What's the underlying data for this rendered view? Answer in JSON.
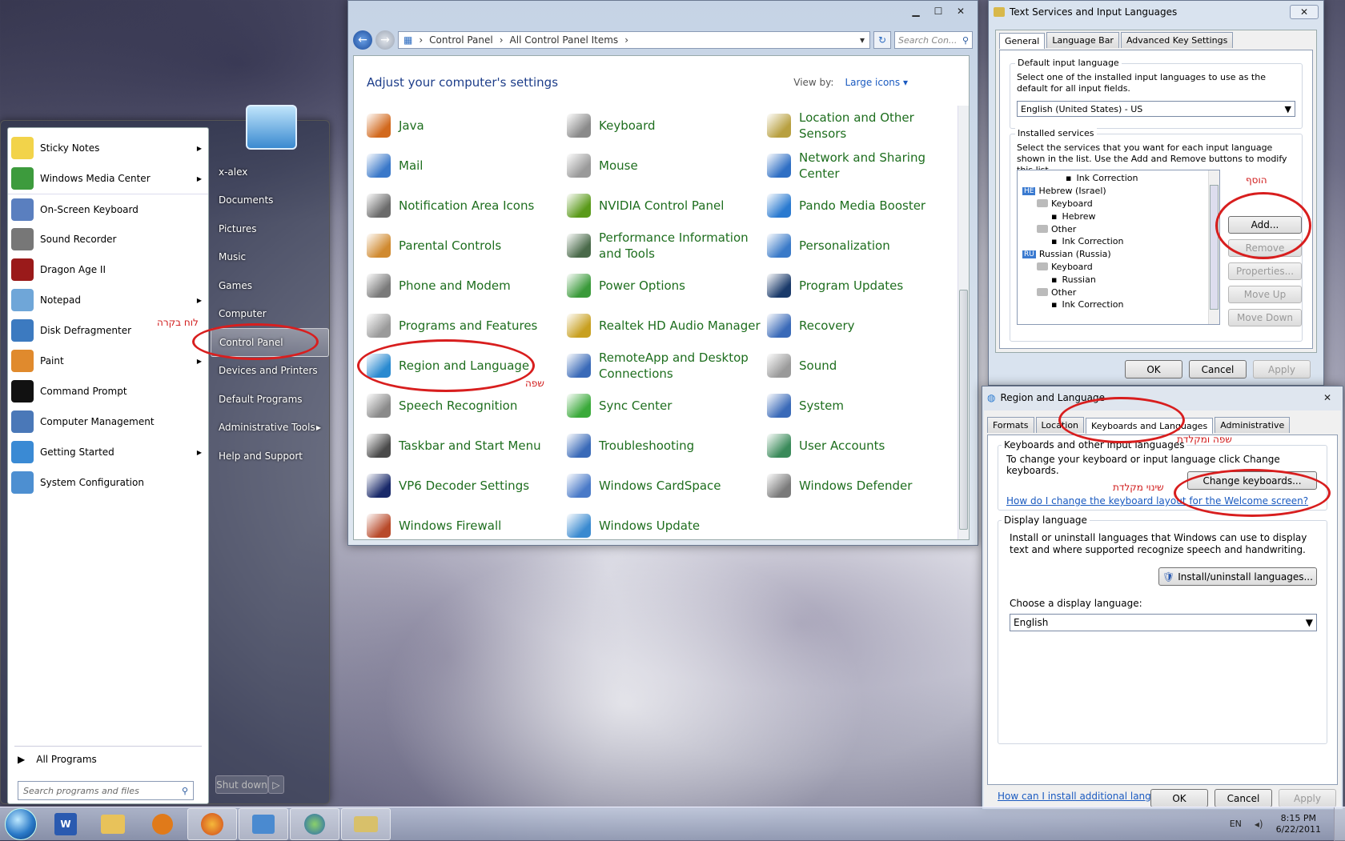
{
  "start_menu": {
    "left_items": [
      {
        "label": "Sticky Notes",
        "arrow": true,
        "color": "#f2d34a"
      },
      {
        "label": "Windows Media Center",
        "arrow": true,
        "color": "#3d9b3d"
      },
      {
        "label": "On-Screen Keyboard",
        "arrow": false,
        "color": "#5a7fbf"
      },
      {
        "label": "Sound Recorder",
        "arrow": false,
        "color": "#777777"
      },
      {
        "label": "Dragon Age II",
        "arrow": false,
        "color": "#9a1a1a"
      },
      {
        "label": "Notepad",
        "arrow": true,
        "color": "#6fa6d8"
      },
      {
        "label": "Disk Defragmenter",
        "arrow": false,
        "color": "#3c7ac0"
      },
      {
        "label": "Paint",
        "arrow": true,
        "color": "#e08a2d"
      },
      {
        "label": "Command Prompt",
        "arrow": false,
        "color": "#111111"
      },
      {
        "label": "Computer Management",
        "arrow": false,
        "color": "#4a78b8"
      },
      {
        "label": "Getting Started",
        "arrow": true,
        "color": "#3a8ad4"
      },
      {
        "label": "System Configuration",
        "arrow": false,
        "color": "#4d8fd1"
      }
    ],
    "all_programs": "All Programs",
    "search_placeholder": "Search programs and files",
    "right_items": [
      {
        "label": "x-alex",
        "arrow": false
      },
      {
        "label": "Documents",
        "arrow": false
      },
      {
        "label": "Pictures",
        "arrow": false
      },
      {
        "label": "Music",
        "arrow": false
      },
      {
        "label": "Games",
        "arrow": false
      },
      {
        "label": "Computer",
        "arrow": false
      },
      {
        "label": "Control Panel",
        "arrow": false
      },
      {
        "label": "Devices and Printers",
        "arrow": false
      },
      {
        "label": "Default Programs",
        "arrow": false
      },
      {
        "label": "Administrative Tools",
        "arrow": true
      },
      {
        "label": "Help and Support",
        "arrow": false
      }
    ],
    "shutdown": "Shut down",
    "annotation": "לוח בקרה"
  },
  "control_panel": {
    "address": [
      "Control Panel",
      "All Control Panel Items"
    ],
    "search_placeholder": "Search Con...",
    "heading": "Adjust your computer's settings",
    "view_by_label": "View by:",
    "view_by_value": "Large icons",
    "annotation": "שפה",
    "items": [
      {
        "label": "Java",
        "color": "#d2691e"
      },
      {
        "label": "Keyboard",
        "color": "#8a8a8a"
      },
      {
        "label": "Location and Other Sensors",
        "color": "#b8a040"
      },
      {
        "label": "Mail",
        "color": "#3a78c9"
      },
      {
        "label": "Mouse",
        "color": "#9a9a9a"
      },
      {
        "label": "Network and Sharing Center",
        "color": "#2f6fc4"
      },
      {
        "label": "Notification Area Icons",
        "color": "#6b6b6b"
      },
      {
        "label": "NVIDIA Control Panel",
        "color": "#5a9a1a"
      },
      {
        "label": "Pando Media Booster",
        "color": "#2a7ad0"
      },
      {
        "label": "Parental Controls",
        "color": "#d08a30"
      },
      {
        "label": "Performance Information and Tools",
        "color": "#4a6a4a"
      },
      {
        "label": "Personalization",
        "color": "#3a7ac8"
      },
      {
        "label": "Phone and Modem",
        "color": "#7a7a7a"
      },
      {
        "label": "Power Options",
        "color": "#3a9a3a"
      },
      {
        "label": "Program Updates",
        "color": "#1a3a6a"
      },
      {
        "label": "Programs and Features",
        "color": "#9a9a9a"
      },
      {
        "label": "Realtek HD Audio Manager",
        "color": "#c8a020"
      },
      {
        "label": "Recovery",
        "color": "#3a6ab8"
      },
      {
        "label": "Region and Language",
        "color": "#2a8ad0"
      },
      {
        "label": "RemoteApp and Desktop Connections",
        "color": "#3a6ab8"
      },
      {
        "label": "Sound",
        "color": "#9a9a9a"
      },
      {
        "label": "Speech Recognition",
        "color": "#8a8a8a"
      },
      {
        "label": "Sync Center",
        "color": "#3aaa3a"
      },
      {
        "label": "System",
        "color": "#3a6ab8"
      },
      {
        "label": "Taskbar and Start Menu",
        "color": "#4a4a4a"
      },
      {
        "label": "Troubleshooting",
        "color": "#3a6ab8"
      },
      {
        "label": "User Accounts",
        "color": "#3a8a5a"
      },
      {
        "label": "VP6 Decoder Settings",
        "color": "#1a2a6a"
      },
      {
        "label": "Windows CardSpace",
        "color": "#4a7ac8"
      },
      {
        "label": "Windows Defender",
        "color": "#7a7a7a"
      },
      {
        "label": "Windows Firewall",
        "color": "#b84a2a"
      },
      {
        "label": "Windows Update",
        "color": "#3a8ad0"
      }
    ]
  },
  "text_services": {
    "title": "Text Services and Input Languages",
    "tabs": [
      "General",
      "Language Bar",
      "Advanced Key Settings"
    ],
    "default_group": "Default input language",
    "default_desc": "Select one of the installed input languages to use as the default for all input fields.",
    "default_value": "English (United States) - US",
    "installed_group": "Installed services",
    "installed_desc": "Select the services that you want for each input language shown in the list. Use the Add and Remove buttons to modify this list.",
    "tree": [
      {
        "text": "Ink Correction",
        "indent": 3,
        "badge": ""
      },
      {
        "text": "Hebrew (Israel)",
        "indent": 0,
        "badge": "HE"
      },
      {
        "text": "Keyboard",
        "indent": 1,
        "badge": ""
      },
      {
        "text": "Hebrew",
        "indent": 2,
        "badge": ""
      },
      {
        "text": "Other",
        "indent": 1,
        "badge": ""
      },
      {
        "text": "Ink Correction",
        "indent": 2,
        "badge": ""
      },
      {
        "text": "Russian (Russia)",
        "indent": 0,
        "badge": "RU"
      },
      {
        "text": "Keyboard",
        "indent": 1,
        "badge": ""
      },
      {
        "text": "Russian",
        "indent": 2,
        "badge": ""
      },
      {
        "text": "Other",
        "indent": 1,
        "badge": ""
      },
      {
        "text": "Ink Correction",
        "indent": 2,
        "badge": ""
      }
    ],
    "buttons": {
      "add": "Add...",
      "remove": "Remove",
      "properties": "Properties...",
      "move_up": "Move Up",
      "move_down": "Move Down"
    },
    "footer": {
      "ok": "OK",
      "cancel": "Cancel",
      "apply": "Apply"
    },
    "annotation": "הוסף"
  },
  "region_language": {
    "title": "Region and Language",
    "tabs": [
      "Formats",
      "Location",
      "Keyboards and Languages",
      "Administrative"
    ],
    "kb_group": "Keyboards and other input languages",
    "kb_desc": "To change your keyboard or input language click Change keyboards.",
    "change_keyboards": "Change keyboards...",
    "kb_link": "How do I change the keyboard layout for the Welcome screen?",
    "display_group": "Display language",
    "display_desc": "Install or uninstall languages that Windows can use to display text and where supported recognize speech and handwriting.",
    "install_btn": "Install/uninstall languages...",
    "choose_label": "Choose a display language:",
    "choose_value": "English",
    "bottom_link": "How can I install additional languages?",
    "footer": {
      "ok": "OK",
      "cancel": "Cancel",
      "apply": "Apply"
    },
    "annotation_tab": "שפה ומקלדת",
    "annotation_btn": "שינוי מקלדת"
  },
  "taskbar": {
    "lang": "EN",
    "time": "8:15 PM",
    "date": "6/22/2011"
  }
}
